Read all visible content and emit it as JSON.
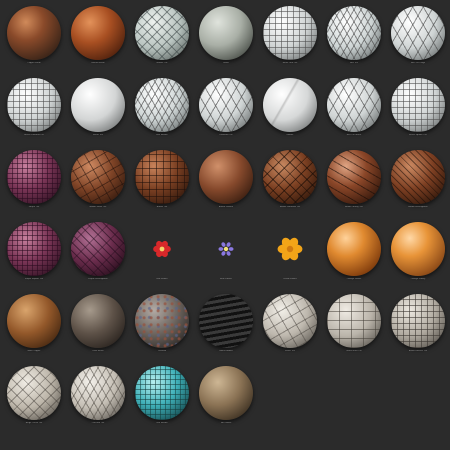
{
  "gallery": {
    "items": [
      {
        "material": "copper",
        "caption": "Copper Metal",
        "sub": ""
      },
      {
        "material": "rust",
        "caption": "Rusted Metal",
        "sub": ""
      },
      {
        "material": "marbletile",
        "caption": "Marble Tile",
        "sub": ""
      },
      {
        "material": "mossy",
        "caption": "Stone",
        "sub": ""
      },
      {
        "material": "whitegrid",
        "caption": "White Grid Tile",
        "sub": ""
      },
      {
        "material": "hexgrid",
        "caption": "Hex Tile",
        "sub": ""
      },
      {
        "material": "hexbig",
        "caption": "Hex Tile Large",
        "sub": ""
      },
      {
        "material": "whitegrid",
        "caption": "White Diamond Tile",
        "sub": ""
      },
      {
        "material": "plainwhite",
        "caption": "White Tile",
        "sub": ""
      },
      {
        "material": "hexgrid",
        "caption": "Hex Mosaic",
        "sub": ""
      },
      {
        "material": "hexbig",
        "caption": "Diamond Tile",
        "sub": ""
      },
      {
        "material": "marble",
        "caption": "Marble",
        "sub": ""
      },
      {
        "material": "hexbig",
        "caption": "Hex Tile White",
        "sub": ""
      },
      {
        "material": "whitegrid",
        "caption": "White Square Tile",
        "sub": ""
      },
      {
        "material": "purpletile",
        "caption": "Purple Tile",
        "sub": ""
      },
      {
        "material": "brownstone",
        "caption": "Brown Stone Tile",
        "sub": ""
      },
      {
        "material": "browntile",
        "caption": "Brown Tile",
        "sub": ""
      },
      {
        "material": "browngranite",
        "caption": "Brown Granite",
        "sub": ""
      },
      {
        "material": "brownharle",
        "caption": "Brown Diamond Tile",
        "sub": ""
      },
      {
        "material": "brownglossy",
        "caption": "Brown Glossy Tile",
        "sub": ""
      },
      {
        "material": "brownherring",
        "caption": "Brown Herringbone",
        "sub": ""
      },
      {
        "material": "purpletile",
        "caption": "Purple Square Tile",
        "sub": ""
      },
      {
        "material": "purpleherring",
        "caption": "Purple Herringbone",
        "sub": ""
      },
      {
        "material": "flower-red",
        "caption": "Red Flower",
        "sub": ""
      },
      {
        "material": "flower-blue",
        "caption": "Blue Flower",
        "sub": ""
      },
      {
        "material": "flower-yellow",
        "caption": "Yellow Flower",
        "sub": ""
      },
      {
        "material": "orange",
        "caption": "Orange Plastic",
        "sub": ""
      },
      {
        "material": "orange2",
        "caption": "Orange Glossy",
        "sub": ""
      },
      {
        "material": "worncopper",
        "caption": "Worn Copper",
        "sub": ""
      },
      {
        "material": "darkmetal",
        "caption": "Dark Metal",
        "sub": ""
      },
      {
        "material": "terrazzo",
        "caption": "Terrazzo",
        "sub": ""
      },
      {
        "material": "blackribbed",
        "caption": "Black Ribbed",
        "sub": ""
      },
      {
        "material": "stone",
        "caption": "Stone Tile",
        "sub": ""
      },
      {
        "material": "stonetile",
        "caption": "Stone Brick Tile",
        "sub": ""
      },
      {
        "material": "basket",
        "caption": "Basket Weave Tile",
        "sub": ""
      },
      {
        "material": "beigecheck",
        "caption": "Beige Check Tile",
        "sub": ""
      },
      {
        "material": "chevron",
        "caption": "Chevron Tile",
        "sub": ""
      },
      {
        "material": "teal",
        "caption": "Teal Mosaic",
        "sub": ""
      },
      {
        "material": "tan",
        "caption": "Tan Plaster",
        "sub": ""
      }
    ]
  },
  "colors": {
    "background": "#2b2b2b"
  }
}
